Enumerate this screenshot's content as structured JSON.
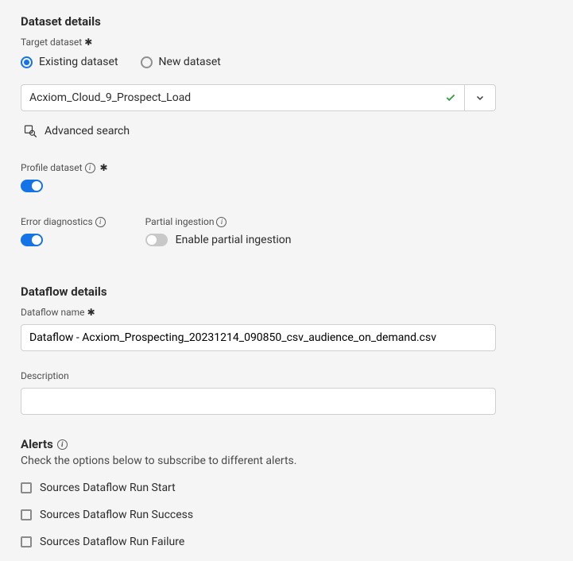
{
  "dataset": {
    "section_title": "Dataset details",
    "target_label": "Target dataset",
    "radio_existing": "Existing dataset",
    "radio_new": "New dataset",
    "selected_value": "Acxiom_Cloud_9_Prospect_Load",
    "advanced_search": "Advanced search",
    "profile_label": "Profile dataset",
    "error_diag_label": "Error diagnostics",
    "partial_label": "Partial ingestion",
    "partial_text": "Enable partial ingestion"
  },
  "dataflow": {
    "section_title": "Dataflow details",
    "name_label": "Dataflow name",
    "name_value": "Dataflow - Acxiom_Prospecting_20231214_090850_csv_audience_on_demand.csv",
    "desc_label": "Description",
    "desc_value": ""
  },
  "alerts": {
    "title": "Alerts",
    "subtitle": "Check the options below to subscribe to different alerts.",
    "items": [
      "Sources Dataflow Run Start",
      "Sources Dataflow Run Success",
      "Sources Dataflow Run Failure"
    ]
  }
}
